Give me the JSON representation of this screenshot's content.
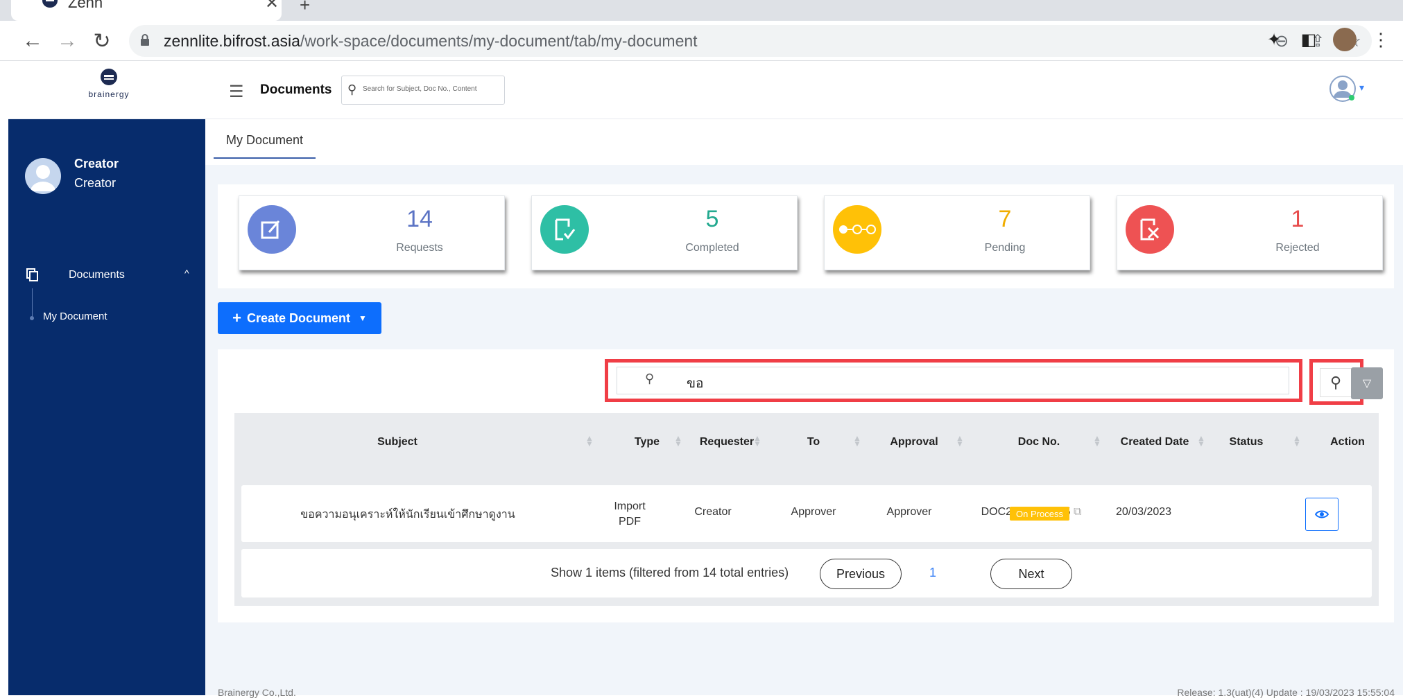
{
  "browser": {
    "tab_title": "Zenn",
    "url_host": "zennlite.bifrost.asia",
    "url_path": "/work-space/documents/my-document/tab/my-document"
  },
  "header": {
    "brand_name": "brainergy",
    "title": "Documents",
    "search_placeholder": "Search for Subject, Doc No., Content"
  },
  "sidebar": {
    "user_name": "Creator",
    "user_role": "Creator",
    "section_label": "Documents",
    "sub_item": "My Document"
  },
  "tabs": [
    {
      "label": "My Document"
    }
  ],
  "stats": [
    {
      "value": "14",
      "label": "Requests",
      "color": "#6a85d9",
      "icon": "edit-icon"
    },
    {
      "value": "5",
      "label": "Completed",
      "color": "#2ebfa5",
      "icon": "check-doc-icon"
    },
    {
      "value": "7",
      "label": "Pending",
      "color": "#ffc107",
      "icon": "flow-icon"
    },
    {
      "value": "1",
      "label": "Rejected",
      "color": "#ee5253",
      "icon": "reject-icon"
    }
  ],
  "create_button": {
    "label": "Create Document"
  },
  "search": {
    "value": "ขอ"
  },
  "table": {
    "columns": [
      "Subject",
      "Type",
      "Requester",
      "To",
      "Approval",
      "Doc No.",
      "Created Date",
      "Status",
      "Action"
    ],
    "rows": [
      {
        "subject": "ขอความอนุเคราะห์ให้นักเรียนเข้าศึกษาดูงาน",
        "type_line1": "Import",
        "type_line2": "PDF",
        "requester": "Creator",
        "to": "Approver",
        "approval": "Approver",
        "doc_no": "DOC2023/001015",
        "created_date": "20/03/2023",
        "status": "On Process"
      }
    ]
  },
  "pager": {
    "info": "Show 1 items (filtered from 14 total entries)",
    "previous": "Previous",
    "page": "1",
    "next": "Next"
  },
  "footer": {
    "company": "Brainergy Co.,Ltd.",
    "release": "Release: 1.3(uat)(4) Update : 19/03/2023 15:55:04"
  },
  "colors": {
    "sidebar": "#072c6c",
    "accent": "#0d6efd",
    "highlight": "#f03e46"
  }
}
